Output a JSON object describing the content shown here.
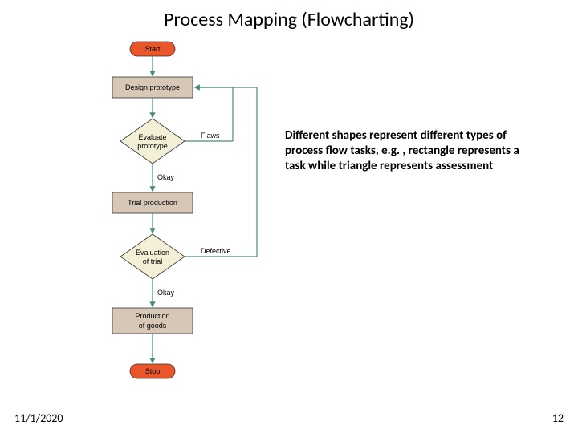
{
  "title": "Process Mapping (Flowcharting)",
  "description": "Different shapes represent different types of process flow tasks, e.g. , rectangle represents a task while triangle represents assessment",
  "footer": {
    "date": "11/1/2020",
    "page": "12"
  },
  "flow": {
    "start": "Start",
    "design": "Design prototype",
    "eval1": {
      "text1": "Evaluate",
      "text2": "prototype",
      "right": "Flaws",
      "down": "Okay"
    },
    "trial": "Trial production",
    "eval2": {
      "text1": "Evaluation",
      "text2": "of trial",
      "right": "Defective",
      "down": "Okay"
    },
    "production_l1": "Production",
    "production_l2": "of goods",
    "stop": "Stop"
  },
  "colors": {
    "terminator": "#e8562a",
    "task": "#d6c7b6",
    "decision": "#f4f0d8",
    "border": "#333",
    "arrow": "#4a8a7a"
  }
}
